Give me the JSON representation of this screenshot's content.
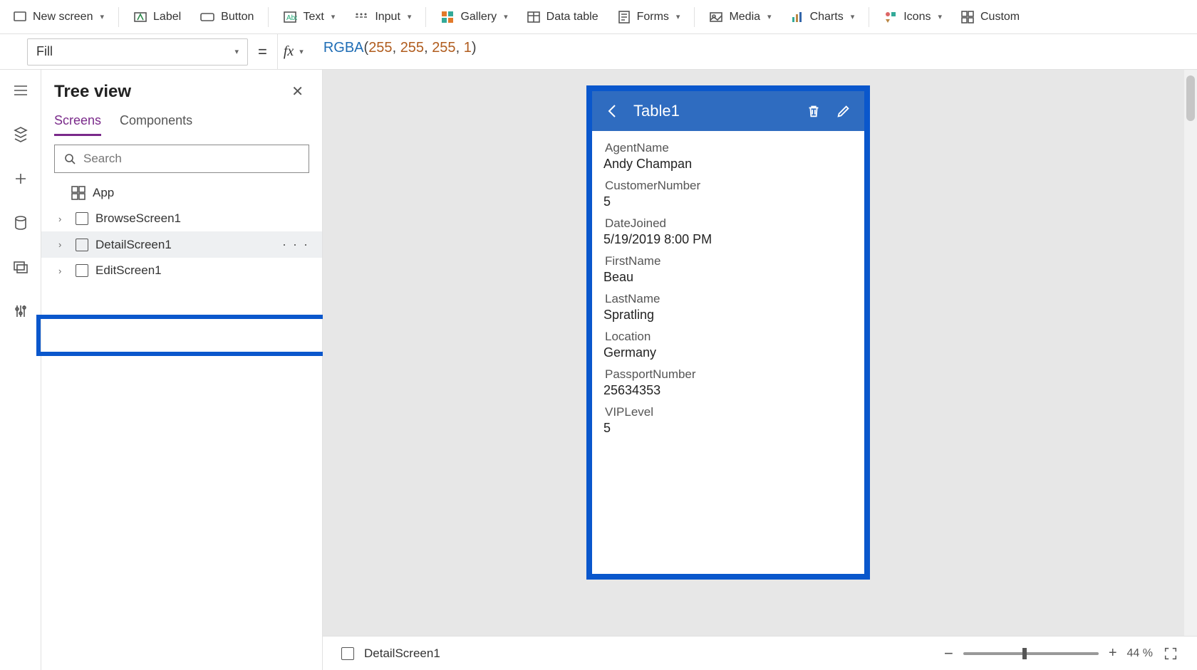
{
  "ribbon": {
    "new_screen": "New screen",
    "label": "Label",
    "button": "Button",
    "text": "Text",
    "input": "Input",
    "gallery": "Gallery",
    "data_table": "Data table",
    "forms": "Forms",
    "media": "Media",
    "charts": "Charts",
    "icons": "Icons",
    "custom": "Custom"
  },
  "formula": {
    "property": "Fill",
    "fx": "fx",
    "fn": "RGBA",
    "args": [
      "255",
      "255",
      "255",
      "1"
    ]
  },
  "tree": {
    "title": "Tree view",
    "tabs": {
      "screens": "Screens",
      "components": "Components"
    },
    "search_placeholder": "Search",
    "app": "App",
    "items": [
      {
        "label": "BrowseScreen1"
      },
      {
        "label": "DetailScreen1"
      },
      {
        "label": "EditScreen1"
      }
    ]
  },
  "phone": {
    "title": "Table1",
    "fields": [
      {
        "label": "AgentName",
        "value": "Andy Champan"
      },
      {
        "label": "CustomerNumber",
        "value": "5"
      },
      {
        "label": "DateJoined",
        "value": "5/19/2019 8:00 PM"
      },
      {
        "label": "FirstName",
        "value": "Beau"
      },
      {
        "label": "LastName",
        "value": "Spratling"
      },
      {
        "label": "Location",
        "value": "Germany"
      },
      {
        "label": "PassportNumber",
        "value": "25634353"
      },
      {
        "label": "VIPLevel",
        "value": "5"
      }
    ]
  },
  "status": {
    "screen": "DetailScreen1",
    "zoom_pct": "44",
    "zoom_unit": "%"
  }
}
